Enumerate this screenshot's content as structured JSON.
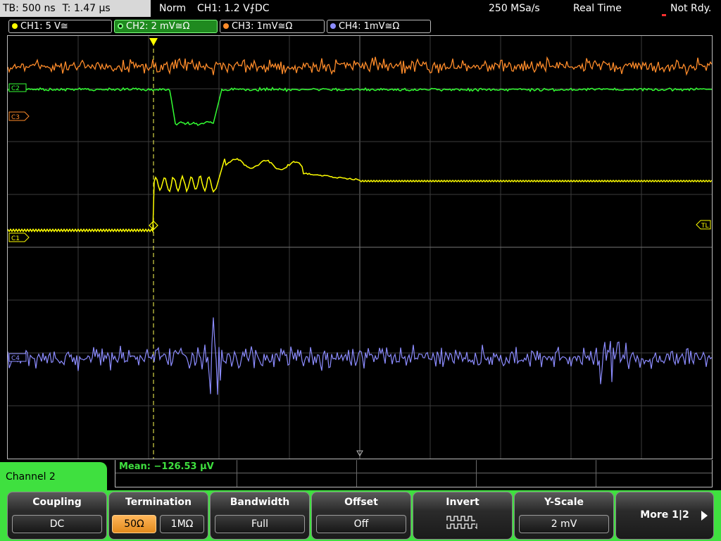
{
  "status": {
    "timebase": "TB: 500 ns",
    "trigger_time": "T: 1.47 µs",
    "mode": "Norm",
    "trigger": "CH1: 1.2 V",
    "trigger_slope_coupling": "⨍DC",
    "sample_rate": "250 MSa/s",
    "acquisition": "Real Time",
    "state": "Not Rdy."
  },
  "channel_tabs": [
    {
      "label": "CH1: 5 V≅",
      "color": "#ffff00"
    },
    {
      "label": "CH2: 2 mV≅Ω",
      "color": "#33ff33"
    },
    {
      "label": "CH3: 1mV≅Ω",
      "color": "#ff8c2a"
    },
    {
      "label": "CH4: 1mV≅Ω",
      "color": "#8c8cff"
    }
  ],
  "markers": {
    "c2": "C2",
    "c3": "C3",
    "c1": "C1",
    "c4": "C4",
    "trigger_level": "TL"
  },
  "measurement": {
    "label": "Mean: −126.53 µV"
  },
  "menu": {
    "channel": "Channel 2"
  },
  "softkeys": {
    "coupling": {
      "title": "Coupling",
      "value": "DC"
    },
    "termination": {
      "title": "Termination",
      "option_a": "50Ω",
      "option_b": "1MΩ",
      "selected": "50Ω"
    },
    "bandwidth": {
      "title": "Bandwidth",
      "value": "Full"
    },
    "offset": {
      "title": "Offset",
      "value": "Off"
    },
    "invert": {
      "title": "Invert",
      "icon": "invert-waveform-icon"
    },
    "yscale": {
      "title": "Y-Scale",
      "value": "2 mV"
    },
    "more": {
      "label": "More 1|2"
    }
  },
  "colors": {
    "ch1": "#ffff00",
    "ch2": "#33ff33",
    "ch3": "#ff8c2a",
    "ch4": "#8c8cff",
    "grid": "#5a5a5a",
    "accent": "#3fe03f"
  }
}
